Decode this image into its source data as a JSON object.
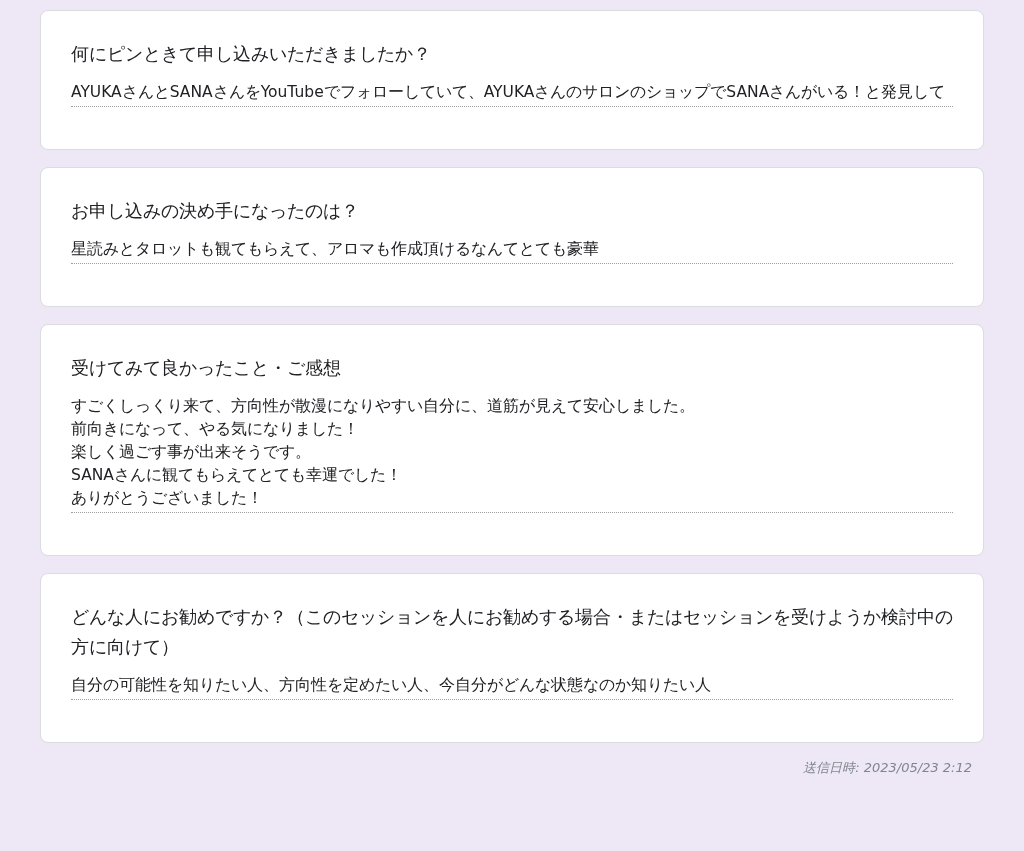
{
  "responses": [
    {
      "question": "何にピンときて申し込みいただきましたか？",
      "answer": [
        "AYUKAさんとSANAさんをYouTubeでフォローしていて、AYUKAさんのサロンのショップでSANAさんがいる！と発見して"
      ]
    },
    {
      "question": "お申し込みの決め手になったのは？",
      "answer": [
        "星読みとタロットも観てもらえて、アロマも作成頂けるなんてとても豪華"
      ]
    },
    {
      "question": "受けてみて良かったこと・ご感想",
      "answer": [
        "すごくしっくり来て、方向性が散漫になりやすい自分に、道筋が見えて安心しました。",
        "前向きになって、やる気になりました！",
        "楽しく過ごす事が出来そうです。",
        "SANAさんに観てもらえてとても幸運でした！",
        "ありがとうございました！"
      ]
    },
    {
      "question": "どんな人にお勧めですか？（このセッションを人にお勧めする場合・またはセッションを受けようか検討中の方に向けて）",
      "answer": [
        "自分の可能性を知りたい人、方向性を定めたい人、今自分がどんな状態なのか知りたい人"
      ]
    }
  ],
  "footer": "送信日時: 2023/05/23 2:12"
}
